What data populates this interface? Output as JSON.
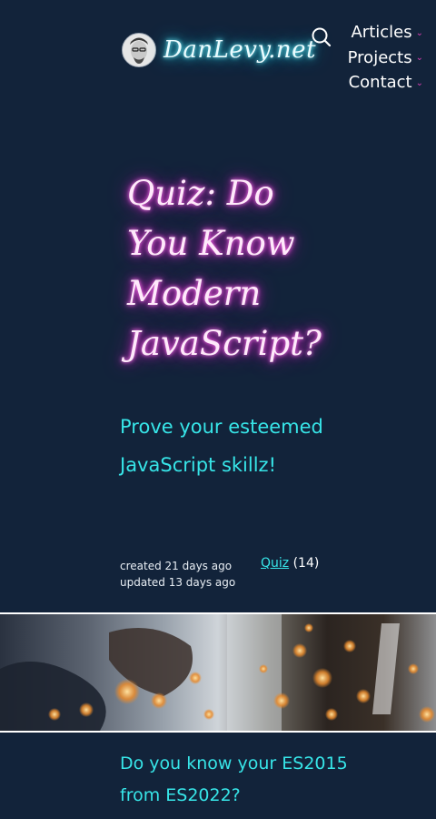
{
  "header": {
    "logo_text": "DanLevy.net",
    "nav": [
      {
        "label": "Articles"
      },
      {
        "label": "Projects"
      },
      {
        "label": "Contact"
      }
    ],
    "icons": {
      "search": "search-icon",
      "chevron": "chevron-down-icon"
    }
  },
  "article": {
    "title": "Quiz: Do You Know Modern JavaScript?",
    "subtitle": "Prove your esteemed JavaScript skillz!",
    "created": "created 21 days ago",
    "updated": "updated 13 days ago",
    "tag_label": "Quiz",
    "tag_count": "(14)"
  },
  "next_section": {
    "text": "Do you know your ES2015 from ES2022?"
  },
  "colors": {
    "background": "#12233a",
    "accent_cyan": "#37e5e8",
    "accent_magenta": "#e829d6"
  }
}
